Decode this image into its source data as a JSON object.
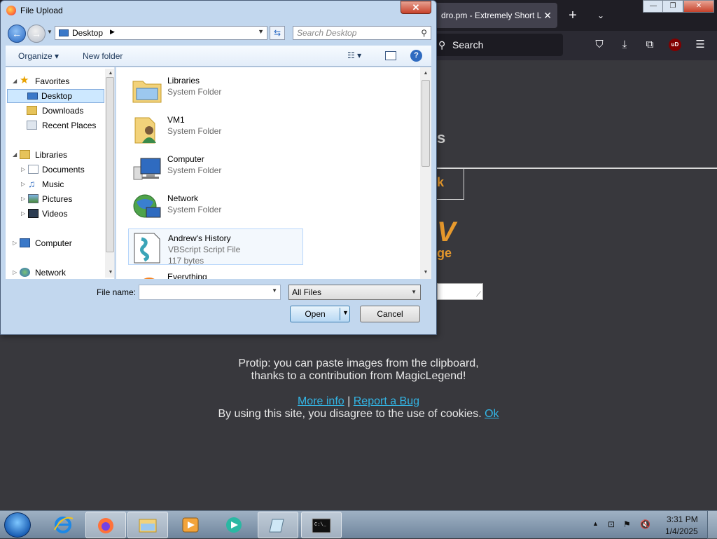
{
  "browser": {
    "tab_title": "dro.pm - Extremely Short L",
    "tab_close": "✕",
    "new_tab": "+",
    "list_tabs": "⌄",
    "search_placeholder": "Search",
    "win_min": "—",
    "win_max": "❐",
    "win_close": "✕",
    "ub_label": "uD"
  },
  "page": {
    "frag_s": "s",
    "frag_k": "k",
    "frag_v": "V",
    "frag_ge": "ge",
    "protip_line1": "Protip: you can paste images from the clipboard,",
    "protip_line2": "thanks to a contribution from MagicLegend!",
    "more_info": "More info",
    "separator": "|",
    "report_bug": "Report a Bug",
    "cookie_text": "By using this site, you disagree to the use of cookies.",
    "cookie_ok": "Ok"
  },
  "dialog": {
    "title": "File Upload",
    "close": "✕",
    "address": "Desktop",
    "search_placeholder": "Search Desktop",
    "organize": "Organize",
    "new_folder": "New folder",
    "help": "?",
    "nav": {
      "favorites": "Favorites",
      "desktop": "Desktop",
      "downloads": "Downloads",
      "recent_places": "Recent Places",
      "libraries": "Libraries",
      "documents": "Documents",
      "music": "Music",
      "pictures": "Pictures",
      "videos": "Videos",
      "computer": "Computer",
      "network": "Network"
    },
    "files": [
      {
        "name": "Libraries",
        "type": "System Folder",
        "size": ""
      },
      {
        "name": "VM1",
        "type": "System Folder",
        "size": ""
      },
      {
        "name": "Computer",
        "type": "System Folder",
        "size": ""
      },
      {
        "name": "Network",
        "type": "System Folder",
        "size": ""
      },
      {
        "name": "Andrew's History",
        "type": "VBScript Script File",
        "size": "117 bytes"
      },
      {
        "name": "Everything",
        "type": "",
        "size": ""
      }
    ],
    "file_name_label": "File name:",
    "file_name_value": "",
    "filter": "All Files",
    "open": "Open",
    "cancel": "Cancel"
  },
  "taskbar": {
    "time": "3:31 PM",
    "date": "1/4/2025"
  }
}
